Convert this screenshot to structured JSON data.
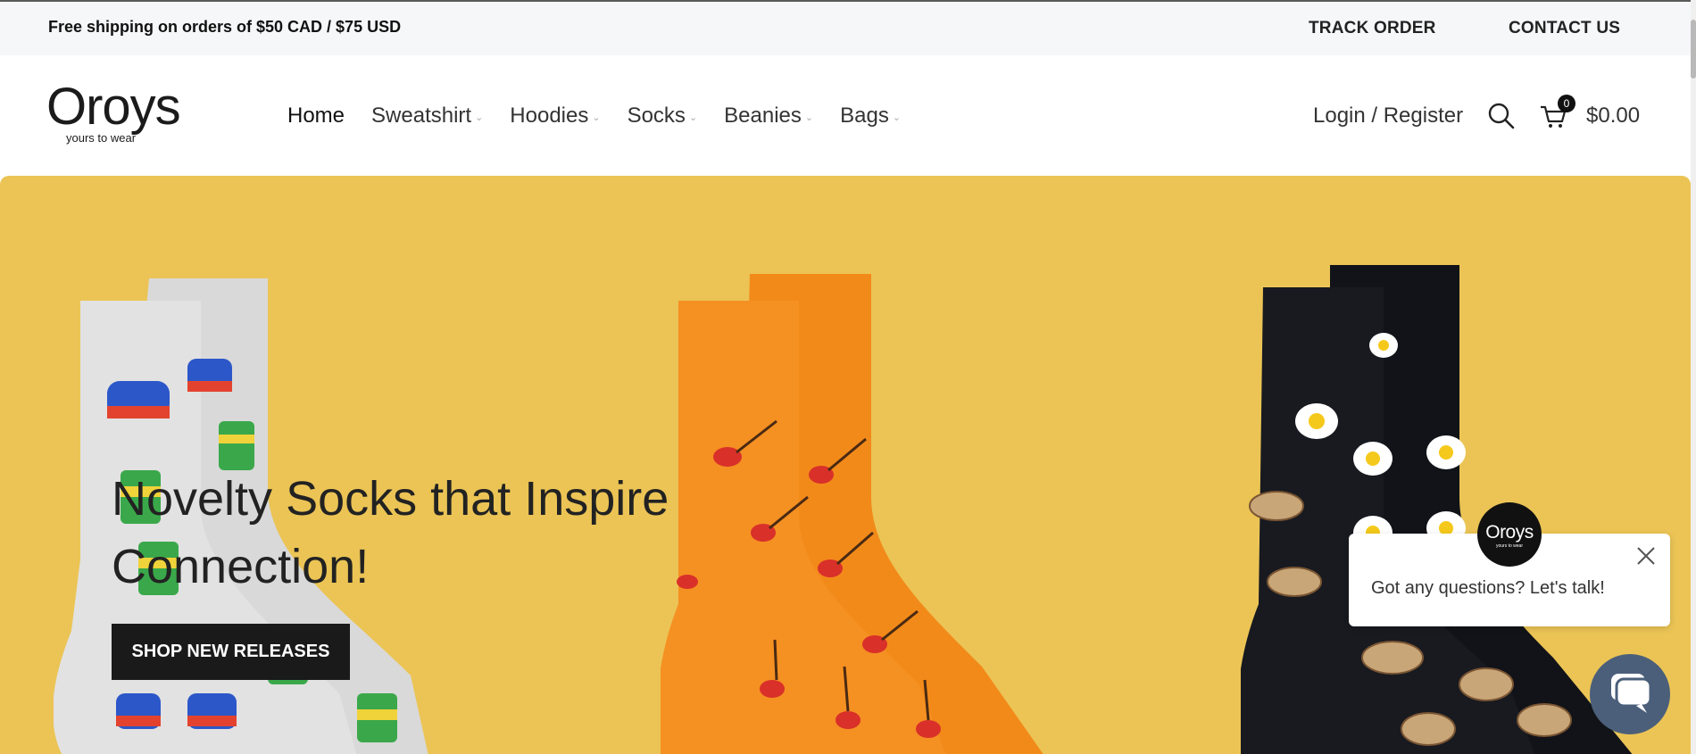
{
  "topbar": {
    "shipping_text": "Free shipping on orders of $50 CAD / $75 USD",
    "track_order": "TRACK ORDER",
    "contact_us": "CONTACT US"
  },
  "logo": {
    "name": "Oroys",
    "tagline": "yours to wear"
  },
  "nav": {
    "items": [
      {
        "label": "Home",
        "has_dropdown": false
      },
      {
        "label": "Sweatshirt",
        "has_dropdown": true
      },
      {
        "label": "Hoodies",
        "has_dropdown": true
      },
      {
        "label": "Socks",
        "has_dropdown": true
      },
      {
        "label": "Beanies",
        "has_dropdown": true
      },
      {
        "label": "Bags",
        "has_dropdown": true
      }
    ]
  },
  "account": {
    "login_register": "Login / Register"
  },
  "cart": {
    "count": "0",
    "total": "$0.00"
  },
  "hero": {
    "title": "Novelty Socks that Inspire Connection!",
    "button_label": "SHOP NEW RELEASES",
    "background_color": "#ebc455"
  },
  "chat": {
    "avatar_name": "Oroys",
    "avatar_tagline": "yours to wear",
    "message": "Got any questions? Let's talk!"
  },
  "icons": {
    "search": "search-icon",
    "cart": "cart-icon",
    "close": "close-icon",
    "chat": "chat-bubble-icon",
    "chevron": "chevron-down-icon"
  }
}
